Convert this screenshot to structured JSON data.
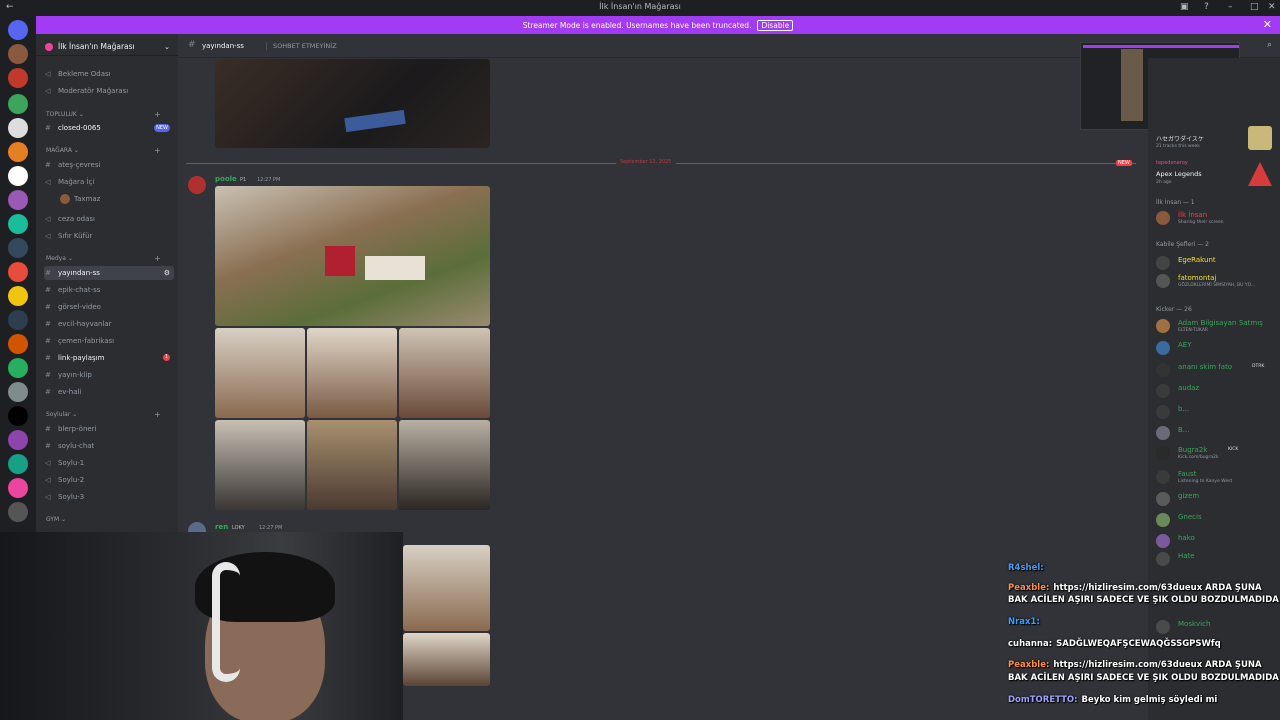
{
  "window": {
    "title": "İlk İnsan'ın Mağarası"
  },
  "banner": {
    "text": "Streamer Mode is enabled. Usernames have been truncated.",
    "disable_label": "Disable"
  },
  "guild": {
    "name": "İlk İnsan'ın Mağarası"
  },
  "channels": {
    "top": [
      "Bekleme Odası",
      "Moderatör Mağarası"
    ],
    "cat_topluluk": "TOPLULUK",
    "closed": "closed-0065",
    "new_badge": "NEW",
    "cat_magara": "MAĞARA",
    "ates": "ateş-çevresi",
    "magara_ici": "Mağara İçi",
    "voice_user": "Taxmaz",
    "ceza": "ceza odası",
    "sifir": "Sıfır Küfür",
    "cat_medya": "Medya",
    "yayindan": "yayından-ss",
    "epik": "epik-chat-ss",
    "gorsel": "görsel-video",
    "evcil": "evcil-hayvanlar",
    "cemen": "çemen-fabrikası",
    "link": "link-paylaşım",
    "link_badge": "1",
    "yayin_klip": "yayın-klip",
    "ev_hali": "ev-hali",
    "cat_soylular": "Soylular",
    "blerp": "blerp-öneri",
    "soylu_chat": "soylu-chat",
    "soylu1": "Soylu-1",
    "soylu2": "Soylu-2",
    "soylu3": "Soylu-3",
    "cat_gym": "GYM"
  },
  "header": {
    "channel": "yayından-ss",
    "topic": "SOHBET ETMEYİNİZ"
  },
  "messages": {
    "divider_date": "September 12, 2025",
    "new_label": "NEW",
    "m1_user": "poole",
    "m1_role": "P1",
    "m1_time": "12:27 PM",
    "m2_user": "ren",
    "m2_role": "LOKY",
    "m2_time": "12:27 PM"
  },
  "members": {
    "act1_title": "ハセガワダイスケ",
    "act1_sub": "21 tracks this week",
    "act2_user": "tepedeneroy",
    "act2_game": "Apex Legends",
    "act2_time": "2h ago",
    "g1": "İlk İnsan — 1",
    "m_ilk": "İlk İnsan",
    "m_ilk_status": "Sharing their screen",
    "g2": "Kabile Şefleri — 2",
    "ege": "EgeRakunt",
    "fato": "fatomontaj",
    "fato_status": "GÖZLÜKLERİMİ SİMSİYAH, BU YÜ...",
    "g3": "Kicker — 26",
    "adam": "Adam Bilgisayarı Satmış",
    "adam_status": "ELTEN-TUKAR",
    "aey": "AEY",
    "anani": "ananı skim fato",
    "anani_tag": "DTRK",
    "audaz": "audaz",
    "b1": "b...",
    "b2": "B...",
    "bugra": "Bugra2k",
    "bugra_tag": "KICK",
    "bugra_status": "Kick.com/bugra2k",
    "faust": "Faust",
    "faust_status": "Listening to Kanye West",
    "gizem": "gizem",
    "gnecis": "Gnecis",
    "hako": "hako",
    "hate": "Hate",
    "moskvich": "Moskvich"
  },
  "overlay_chat": [
    {
      "user": "R4shel:",
      "text": "",
      "user_color": "#3aa0ff"
    },
    {
      "user": "Peaxble:",
      "text": "https://hizliresim.com/63dueux ARDA ŞUNA",
      "user_color": "#ff8f3f"
    },
    {
      "user": "",
      "text": "BAK ACİLEN AŞIRI SADECE VE ŞIK OLDU BOZDULMADIDA",
      "user_color": "#ffffff"
    },
    {
      "user": "Nrax1:",
      "text": "",
      "user_color": "#3aa0ff"
    },
    {
      "user": "cuhanna:",
      "text": "SADĞLWEQAFŞCEWAQĞSSGPSWfq",
      "user_color": "#ffffff"
    },
    {
      "user": "Peaxble:",
      "text": "https://hizliresim.com/63dueux ARDA ŞUNA",
      "user_color": "#ff8f3f"
    },
    {
      "user": "",
      "text": "BAK ACİLEN AŞIRI SADECE VE ŞIK OLDU BOZDULMADIDA",
      "user_color": "#ffffff"
    },
    {
      "user": "DomTORETTO:",
      "text": "Beyko kim gelmiş söyledi mi",
      "user_color": "#a0a0ff"
    }
  ],
  "colors": {
    "accent": "#a23cf4",
    "new": "#f23f43",
    "member_green": "#3ba55c"
  }
}
